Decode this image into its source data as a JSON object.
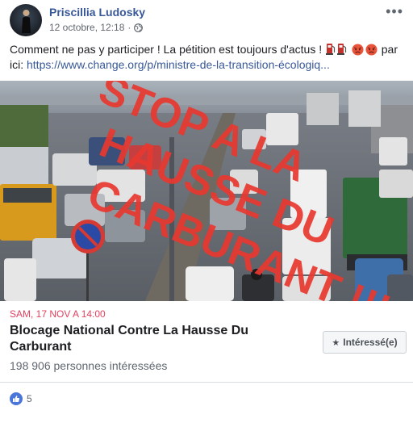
{
  "post": {
    "author": "Priscillia Ludosky",
    "timestamp": "12 octobre, 12:18",
    "separator": "·",
    "privacy_icon": "globe-icon",
    "more_label": "•••",
    "text_before": "Comment ne pas y participer ! La pétition est toujours d'actus !",
    "text_after": " par ici: ",
    "link": "https://www.change.org/p/ministre-de-la-transition-écologiq...",
    "emoji_icons": [
      "fuel-pump-icon",
      "fuel-pump-icon",
      "angry-face-icon",
      "angry-face-icon"
    ]
  },
  "image": {
    "overlay_lines": [
      "STOP A LA",
      "HAUSSE DU",
      "CARBURANT !!!"
    ],
    "overlay_color": "#e8382f"
  },
  "event": {
    "date": "SAM, 17 NOV A 14:00",
    "title": "Blocage National Contre La Hausse Du Carburant",
    "interested_count": "198 906 personnes intéressées",
    "button_label": "Intéressé(e)",
    "button_icon": "star-icon"
  },
  "reactions": {
    "icon": "like-icon",
    "count": "5",
    "color": "#4a76d9"
  }
}
